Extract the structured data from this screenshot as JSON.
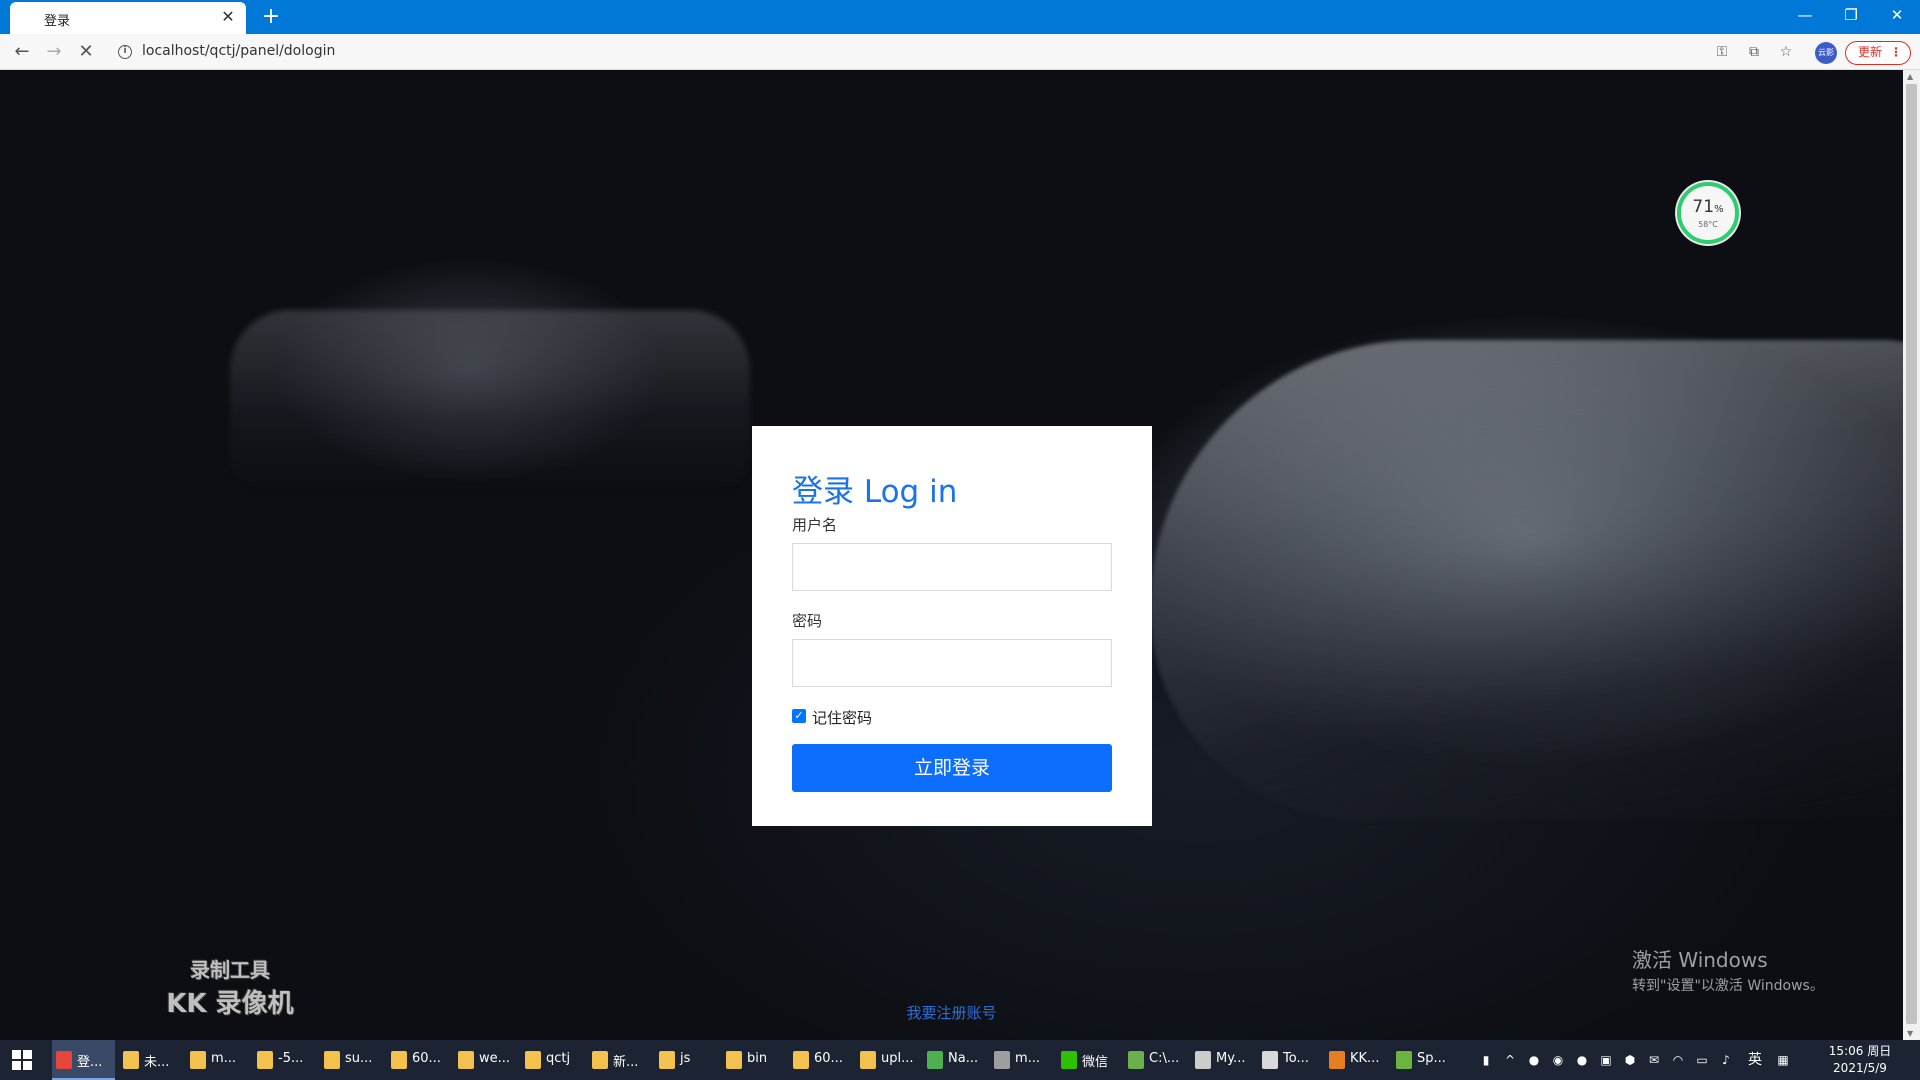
{
  "browser": {
    "tab_title": "登录",
    "tab_close": "✕",
    "new_tab": "+",
    "url": "localhost/qctj/panel/dologin",
    "update_label": "更新",
    "profile_initials": "云影"
  },
  "login": {
    "title": "登录 Log in",
    "username_label": "用户名",
    "username_value": "",
    "password_label": "密码",
    "password_value": "",
    "remember_label": "记住密码",
    "remember_checked": true,
    "submit_label": "立即登录"
  },
  "register_link": "我要注册账号",
  "cpu_widget": {
    "percent": "71",
    "unit": "%",
    "temperature": "58°C"
  },
  "watermark": {
    "line1": "录制工具",
    "line2": "KK 录像机"
  },
  "activation": {
    "title": "激活 Windows",
    "subtitle": "转到\"设置\"以激活 Windows。"
  },
  "taskbar": {
    "items": [
      {
        "label": "登...",
        "icon": "chrome-icon",
        "color": "#e8453c"
      },
      {
        "label": "未...",
        "icon": "folder-icon",
        "color": "#f2c14e"
      },
      {
        "label": "m...",
        "icon": "folder-icon",
        "color": "#f2c14e"
      },
      {
        "label": "-5...",
        "icon": "folder-icon",
        "color": "#f2c14e"
      },
      {
        "label": "su...",
        "icon": "folder-icon",
        "color": "#f2c14e"
      },
      {
        "label": "60...",
        "icon": "folder-icon",
        "color": "#f2c14e"
      },
      {
        "label": "we...",
        "icon": "folder-icon",
        "color": "#f2c14e"
      },
      {
        "label": "qctj",
        "icon": "folder-icon",
        "color": "#f2c14e"
      },
      {
        "label": "新...",
        "icon": "folder-icon",
        "color": "#f2c14e"
      },
      {
        "label": "js",
        "icon": "folder-icon",
        "color": "#f2c14e"
      },
      {
        "label": "bin",
        "icon": "folder-icon",
        "color": "#f2c14e"
      },
      {
        "label": "60...",
        "icon": "folder-icon",
        "color": "#f2c14e"
      },
      {
        "label": "upl...",
        "icon": "folder-icon",
        "color": "#f2c14e"
      },
      {
        "label": "Na...",
        "icon": "navicat-icon",
        "color": "#4caf50"
      },
      {
        "label": "m...",
        "icon": "app-icon",
        "color": "#9e9e9e"
      },
      {
        "label": "微信",
        "icon": "wechat-icon",
        "color": "#2dc100"
      },
      {
        "label": "C:\\...",
        "icon": "terminal-icon",
        "color": "#6ab04c"
      },
      {
        "label": "My...",
        "icon": "mysql-icon",
        "color": "#cccccc"
      },
      {
        "label": "To...",
        "icon": "tomcat-icon",
        "color": "#d9d9d9"
      },
      {
        "label": "KK...",
        "icon": "kk-recorder-icon",
        "color": "#e67e22"
      },
      {
        "label": "Sp...",
        "icon": "spring-icon",
        "color": "#6db33f"
      }
    ],
    "tray": [
      "battery-icon",
      "chevron-up-icon",
      "app-tray-icon",
      "qq-icon",
      "tray-app-icon",
      "network-box-icon",
      "shield-icon",
      "wechat-tray-icon",
      "wifi-icon",
      "monitor-icon",
      "volume-icon"
    ],
    "ime_label": "英",
    "clock_time": "15:06 周日",
    "clock_date": "2021/5/9"
  },
  "colors": {
    "accent": "#1a73e8",
    "button": "#0d6efd",
    "titlebar": "#0078d7",
    "taskbar": "#1c2433"
  }
}
